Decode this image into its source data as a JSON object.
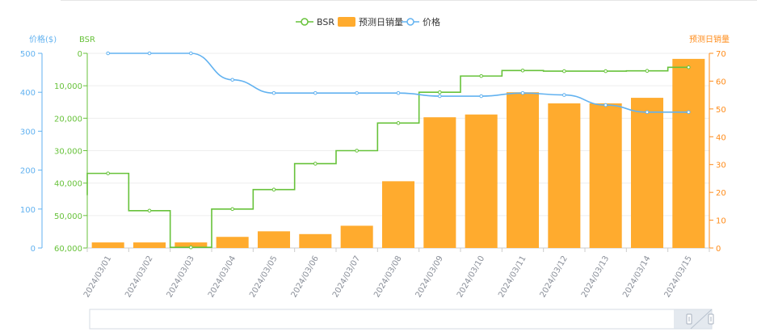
{
  "legend": [
    {
      "label": "BSR",
      "kind": "line",
      "color": "#67c23a"
    },
    {
      "label": "预测日销量",
      "kind": "bar",
      "color": "#ffab2e"
    },
    {
      "label": "价格",
      "kind": "line",
      "color": "#62b2f0"
    }
  ],
  "axes": {
    "price_title": "价格($)",
    "bsr_title": "BSR",
    "sales_title": "预测日销量",
    "price_ticks": [
      "500",
      "400",
      "300",
      "200",
      "100",
      "0"
    ],
    "bsr_ticks": [
      "0",
      "10,000",
      "20,000",
      "30,000",
      "40,000",
      "50,000",
      "60,000"
    ],
    "sales_ticks": [
      "70",
      "60",
      "50",
      "40",
      "30",
      "20",
      "10",
      "0"
    ]
  },
  "colors": {
    "bsr": "#67c23a",
    "sales": "#ffab2e",
    "price": "#62b2f0",
    "grid": "#eeeeee",
    "axis_label": "#8a8f99"
  },
  "chart_data": {
    "type": "bar",
    "categories": [
      "2024/03/01",
      "2024/03/02",
      "2024/03/03",
      "2024/03/04",
      "2024/03/05",
      "2024/03/06",
      "2024/03/07",
      "2024/03/08",
      "2024/03/09",
      "2024/03/10",
      "2024/03/11",
      "2024/03/12",
      "2024/03/13",
      "2024/03/14",
      "2024/03/15"
    ],
    "series": [
      {
        "name": "预测日销量",
        "type": "bar",
        "axis": "right",
        "values": [
          2,
          2,
          2,
          4,
          6,
          5,
          8,
          24,
          47,
          48,
          56,
          52,
          52,
          54,
          68
        ]
      },
      {
        "name": "BSR",
        "type": "step-line",
        "axis": "left-inverted",
        "values": [
          37000,
          48500,
          59800,
          48000,
          42000,
          34000,
          30000,
          21500,
          12000,
          7000,
          5300,
          5500,
          5500,
          5400,
          4300
        ]
      },
      {
        "name": "价格",
        "type": "line",
        "axis": "left",
        "values": [
          500,
          500,
          500,
          432,
          398,
          398,
          398,
          398,
          390,
          390,
          398,
          393,
          367,
          349,
          349
        ]
      }
    ],
    "price_range": [
      0,
      500
    ],
    "bsr_range": [
      0,
      60000
    ],
    "sales_range": [
      0,
      70
    ],
    "grid": true,
    "legend_position": "top-center",
    "has_zoom_slider": true
  }
}
